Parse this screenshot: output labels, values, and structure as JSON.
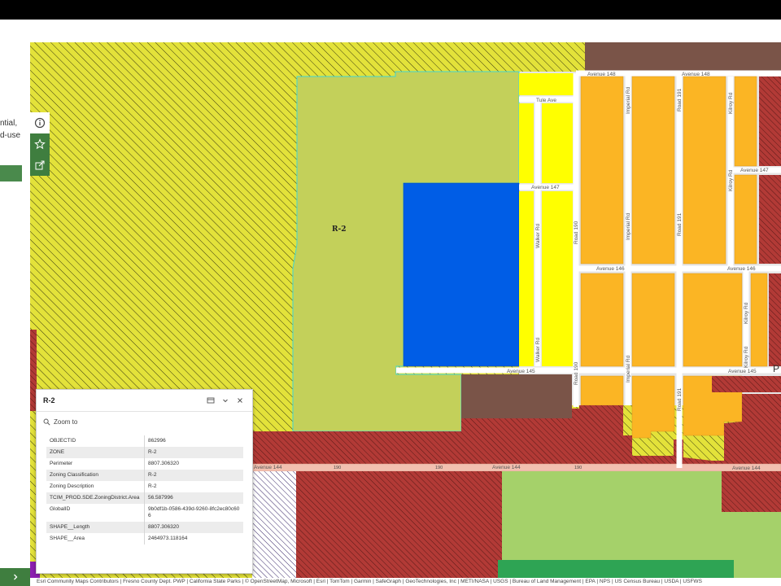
{
  "left_panel": {
    "snippet_line1": "ntial,",
    "snippet_line2": "d-use"
  },
  "map_tools": [
    {
      "icon": "info-icon"
    },
    {
      "icon": "star-icon"
    },
    {
      "icon": "share-icon"
    }
  ],
  "map": {
    "zone_label": "R-2",
    "cut_label": "P",
    "roads": {
      "avenue_148": "Avenue 148",
      "tule_ave": "Tule Ave",
      "avenue_147": "Avenue 147",
      "avenue_146": "Avenue 146",
      "avenue_145": "Avenue 145",
      "avenue_144": "Avenue 144",
      "imperial_rd": "Imperial Rd",
      "road_191": "Road 191",
      "road_190": "Road 190",
      "walker_rd": "Walker Rd",
      "kilroy_rd": "Kilroy Rd",
      "route_190": "190"
    },
    "colors": {
      "agricultural_hatch_bg": "#e8e83a",
      "r2_fill": "#c3d05a",
      "blue_parcel": "#005de6",
      "bright_yellow": "#ffff00",
      "orange_parcels": "#fbb524",
      "brown_parcels": "#7a5448",
      "red_hatch": "#b23a36",
      "light_green": "#a5d16a",
      "dark_green": "#2ea454",
      "purple": "#8c1fb0"
    }
  },
  "popup": {
    "title": "R-2",
    "zoom_label": "Zoom to",
    "attributes": [
      {
        "key": "OBJECTID",
        "value": "862996"
      },
      {
        "key": "ZONE",
        "value": "R-2"
      },
      {
        "key": "Perimeter",
        "value": "8807.306320"
      },
      {
        "key": "Zoning Classification",
        "value": "R-2"
      },
      {
        "key": "Zoning Description",
        "value": "R-2"
      },
      {
        "key": "TCIM_PROD.SDE.ZoningDistrict.Area",
        "value": "56.587996"
      },
      {
        "key": "GlobalID",
        "value": "9b0df1b-0586-439d-9260-8fc2ec80c606"
      },
      {
        "key": "SHAPE__Length",
        "value": "8807.306320"
      },
      {
        "key": "SHAPE__Area",
        "value": "2464973.118164"
      }
    ]
  },
  "attribution": "Esri Community Maps Contributors | Fresno County Dept. PWP | California State Parks | © OpenStreetMap, Microsoft | Esri | TomTom | Garmin | SafeGraph | GeoTechnologies, Inc | METI/NASA | USGS | Bureau of Land Management | EPA | NPS | US Census Bureau | USDA | USFWS"
}
